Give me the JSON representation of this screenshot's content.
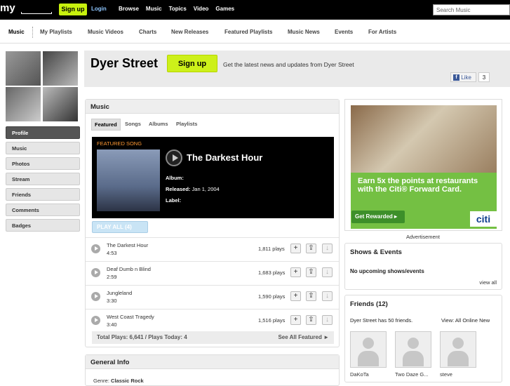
{
  "topbar": {
    "logo": "my",
    "signup_label": "Sign up",
    "login_label": "Login",
    "nav": [
      "Browse",
      "Music",
      "Topics",
      "Video",
      "Games"
    ],
    "search_placeholder": "Search Music"
  },
  "subnav": [
    "Music",
    "My Playlists",
    "Music Videos",
    "Charts",
    "New Releases",
    "Featured Playlists",
    "Music News",
    "Events",
    "For Artists"
  ],
  "sidebar": [
    "Profile",
    "Music",
    "Photos",
    "Stream",
    "Friends",
    "Comments",
    "Badges"
  ],
  "artist": {
    "name": "Dyer Street",
    "signup_label": "Sign up",
    "tagline": "Get the latest news and updates from Dyer Street",
    "like_label": "Like",
    "like_count": "3"
  },
  "music": {
    "title": "Music",
    "tabs": [
      "Featured",
      "Songs",
      "Albums",
      "Playlists"
    ],
    "featured_label": "FEATURED SONG",
    "featured_title": "The Darkest Hour",
    "album_label": "Album:",
    "album_value": "",
    "released_label": "Released:",
    "released_value": "Jan 1, 2004",
    "label_label": "Label:",
    "label_value": "",
    "play_all": "PLAY ALL (4)",
    "tracks": [
      {
        "name": "The Darkest Hour",
        "duration": "4:53",
        "plays": "1,811 plays"
      },
      {
        "name": "Deaf Dumb n Blind",
        "duration": "2:59",
        "plays": "1,683 plays"
      },
      {
        "name": "Jungleland",
        "duration": "3:30",
        "plays": "1,590 plays"
      },
      {
        "name": "West Coast Tragedy",
        "duration": "3:40",
        "plays": "1,516 plays"
      }
    ],
    "totals": "Total Plays: 6,641 / Plays Today: 4",
    "see_all": "See All Featured ►"
  },
  "general": {
    "title": "General Info",
    "genre_label": "Genre:",
    "genre_value": "Classic Rock"
  },
  "ad": {
    "text": "Earn 5x the points at restaurants with the Citi® Forward Card.",
    "cta": "Get Rewarded ▸",
    "brand": "citi",
    "label": "Advertisement"
  },
  "shows": {
    "title": "Shows & Events",
    "empty": "No upcoming shows/events",
    "view_all": "view all"
  },
  "friends": {
    "title": "Friends (12)",
    "summary": "Dyer Street has 50 friends.",
    "view_label": "View:",
    "view_options": [
      "All",
      "Online",
      "New"
    ],
    "names": [
      "DaKoTa",
      "Two Daze G...",
      "steve"
    ]
  },
  "colors": {
    "accent": "#cdf01a",
    "link": "#8ec6ff",
    "featured_label": "#ff9933",
    "ad_green": "#74c043"
  }
}
